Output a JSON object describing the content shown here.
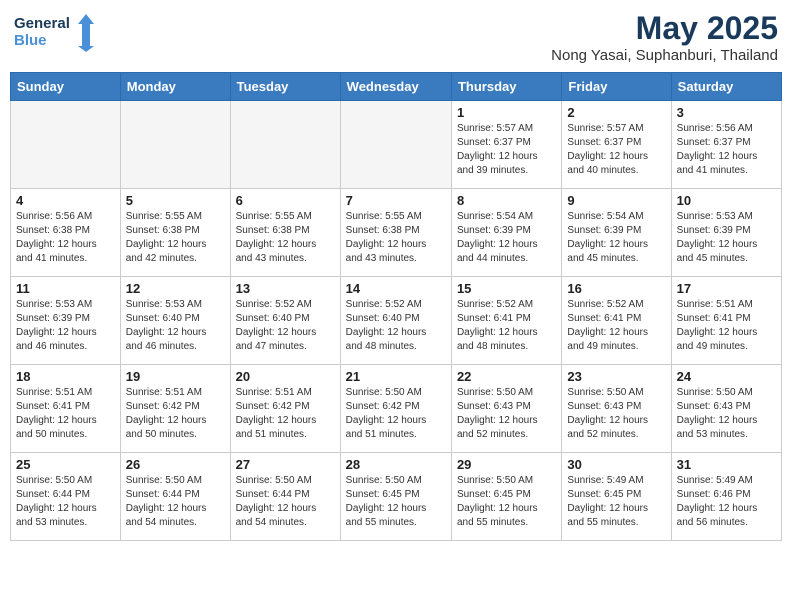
{
  "header": {
    "logo_line1": "General",
    "logo_line2": "Blue",
    "month_year": "May 2025",
    "location": "Nong Yasai, Suphanburi, Thailand"
  },
  "weekdays": [
    "Sunday",
    "Monday",
    "Tuesday",
    "Wednesday",
    "Thursday",
    "Friday",
    "Saturday"
  ],
  "weeks": [
    [
      {
        "day": "",
        "info": ""
      },
      {
        "day": "",
        "info": ""
      },
      {
        "day": "",
        "info": ""
      },
      {
        "day": "",
        "info": ""
      },
      {
        "day": "1",
        "info": "Sunrise: 5:57 AM\nSunset: 6:37 PM\nDaylight: 12 hours\nand 39 minutes."
      },
      {
        "day": "2",
        "info": "Sunrise: 5:57 AM\nSunset: 6:37 PM\nDaylight: 12 hours\nand 40 minutes."
      },
      {
        "day": "3",
        "info": "Sunrise: 5:56 AM\nSunset: 6:37 PM\nDaylight: 12 hours\nand 41 minutes."
      }
    ],
    [
      {
        "day": "4",
        "info": "Sunrise: 5:56 AM\nSunset: 6:38 PM\nDaylight: 12 hours\nand 41 minutes."
      },
      {
        "day": "5",
        "info": "Sunrise: 5:55 AM\nSunset: 6:38 PM\nDaylight: 12 hours\nand 42 minutes."
      },
      {
        "day": "6",
        "info": "Sunrise: 5:55 AM\nSunset: 6:38 PM\nDaylight: 12 hours\nand 43 minutes."
      },
      {
        "day": "7",
        "info": "Sunrise: 5:55 AM\nSunset: 6:38 PM\nDaylight: 12 hours\nand 43 minutes."
      },
      {
        "day": "8",
        "info": "Sunrise: 5:54 AM\nSunset: 6:39 PM\nDaylight: 12 hours\nand 44 minutes."
      },
      {
        "day": "9",
        "info": "Sunrise: 5:54 AM\nSunset: 6:39 PM\nDaylight: 12 hours\nand 45 minutes."
      },
      {
        "day": "10",
        "info": "Sunrise: 5:53 AM\nSunset: 6:39 PM\nDaylight: 12 hours\nand 45 minutes."
      }
    ],
    [
      {
        "day": "11",
        "info": "Sunrise: 5:53 AM\nSunset: 6:39 PM\nDaylight: 12 hours\nand 46 minutes."
      },
      {
        "day": "12",
        "info": "Sunrise: 5:53 AM\nSunset: 6:40 PM\nDaylight: 12 hours\nand 46 minutes."
      },
      {
        "day": "13",
        "info": "Sunrise: 5:52 AM\nSunset: 6:40 PM\nDaylight: 12 hours\nand 47 minutes."
      },
      {
        "day": "14",
        "info": "Sunrise: 5:52 AM\nSunset: 6:40 PM\nDaylight: 12 hours\nand 48 minutes."
      },
      {
        "day": "15",
        "info": "Sunrise: 5:52 AM\nSunset: 6:41 PM\nDaylight: 12 hours\nand 48 minutes."
      },
      {
        "day": "16",
        "info": "Sunrise: 5:52 AM\nSunset: 6:41 PM\nDaylight: 12 hours\nand 49 minutes."
      },
      {
        "day": "17",
        "info": "Sunrise: 5:51 AM\nSunset: 6:41 PM\nDaylight: 12 hours\nand 49 minutes."
      }
    ],
    [
      {
        "day": "18",
        "info": "Sunrise: 5:51 AM\nSunset: 6:41 PM\nDaylight: 12 hours\nand 50 minutes."
      },
      {
        "day": "19",
        "info": "Sunrise: 5:51 AM\nSunset: 6:42 PM\nDaylight: 12 hours\nand 50 minutes."
      },
      {
        "day": "20",
        "info": "Sunrise: 5:51 AM\nSunset: 6:42 PM\nDaylight: 12 hours\nand 51 minutes."
      },
      {
        "day": "21",
        "info": "Sunrise: 5:50 AM\nSunset: 6:42 PM\nDaylight: 12 hours\nand 51 minutes."
      },
      {
        "day": "22",
        "info": "Sunrise: 5:50 AM\nSunset: 6:43 PM\nDaylight: 12 hours\nand 52 minutes."
      },
      {
        "day": "23",
        "info": "Sunrise: 5:50 AM\nSunset: 6:43 PM\nDaylight: 12 hours\nand 52 minutes."
      },
      {
        "day": "24",
        "info": "Sunrise: 5:50 AM\nSunset: 6:43 PM\nDaylight: 12 hours\nand 53 minutes."
      }
    ],
    [
      {
        "day": "25",
        "info": "Sunrise: 5:50 AM\nSunset: 6:44 PM\nDaylight: 12 hours\nand 53 minutes."
      },
      {
        "day": "26",
        "info": "Sunrise: 5:50 AM\nSunset: 6:44 PM\nDaylight: 12 hours\nand 54 minutes."
      },
      {
        "day": "27",
        "info": "Sunrise: 5:50 AM\nSunset: 6:44 PM\nDaylight: 12 hours\nand 54 minutes."
      },
      {
        "day": "28",
        "info": "Sunrise: 5:50 AM\nSunset: 6:45 PM\nDaylight: 12 hours\nand 55 minutes."
      },
      {
        "day": "29",
        "info": "Sunrise: 5:50 AM\nSunset: 6:45 PM\nDaylight: 12 hours\nand 55 minutes."
      },
      {
        "day": "30",
        "info": "Sunrise: 5:49 AM\nSunset: 6:45 PM\nDaylight: 12 hours\nand 55 minutes."
      },
      {
        "day": "31",
        "info": "Sunrise: 5:49 AM\nSunset: 6:46 PM\nDaylight: 12 hours\nand 56 minutes."
      }
    ]
  ]
}
